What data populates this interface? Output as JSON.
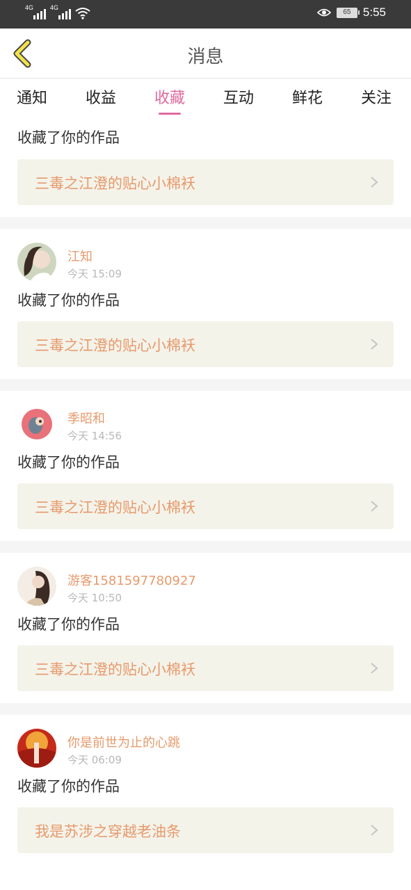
{
  "status_bar": {
    "signal1_label": "4G",
    "signal2_label": "4G",
    "battery": "65",
    "time": "5:55"
  },
  "header": {
    "title": "消息"
  },
  "tabs": [
    {
      "label": "通知"
    },
    {
      "label": "收益"
    },
    {
      "label": "收藏"
    },
    {
      "label": "互动"
    },
    {
      "label": "鲜花"
    },
    {
      "label": "关注"
    }
  ],
  "active_tab": "收藏",
  "feed": {
    "first_partial": {
      "action": "收藏了你的作品",
      "work_title": "三毒之江澄的贴心小棉袄"
    },
    "items": [
      {
        "user": "江知",
        "time": "今天 15:09",
        "action": "收藏了你的作品",
        "work_title": "三毒之江澄的贴心小棉袄"
      },
      {
        "user": "季昭和",
        "time": "今天 14:56",
        "action": "收藏了你的作品",
        "work_title": "三毒之江澄的贴心小棉袄"
      },
      {
        "user": "游客1581597780927",
        "time": "今天 10:50",
        "action": "收藏了你的作品",
        "work_title": "三毒之江澄的贴心小棉袄"
      },
      {
        "user": "你是前世为止的心跳",
        "time": "今天 06:09",
        "action": "收藏了你的作品",
        "work_title": "我是苏涉之穿越老油条"
      }
    ]
  },
  "colors": {
    "accent_pink": "#e06aa0",
    "username_orange": "#e69a6c",
    "card_bg": "#f4f3ea",
    "back_arrow": "#f2e24a"
  }
}
